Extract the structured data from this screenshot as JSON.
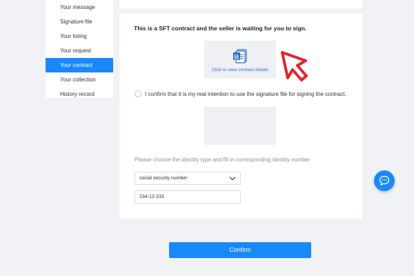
{
  "sidebar": {
    "items": [
      {
        "label": "Your message"
      },
      {
        "label": "Signature file"
      },
      {
        "label": "Your listing"
      },
      {
        "label": "Your request"
      },
      {
        "label": "Your contract"
      },
      {
        "label": "Your collection"
      },
      {
        "label": "History record"
      }
    ],
    "active_item": "Your contract"
  },
  "contract": {
    "headline": "This is a SFT contract and the seller is waiting for you to sign.",
    "doc_link": "Click to view contract details",
    "doc_icon": "word-document-icon",
    "confirm_text": "I confirm that it is my real intention to use the signature file for signing the contract.",
    "identity_hint": "Please choose the identity type and fill in corresponding identity number",
    "identity_type": "social security number",
    "identity_number": "234-12-233"
  },
  "confirm_button": "Confirm",
  "chat_icon": "chat-bubble-icon",
  "colors": {
    "accent": "#1989fa",
    "cursor_red": "#e0242b",
    "background": "#f0f2f5"
  }
}
